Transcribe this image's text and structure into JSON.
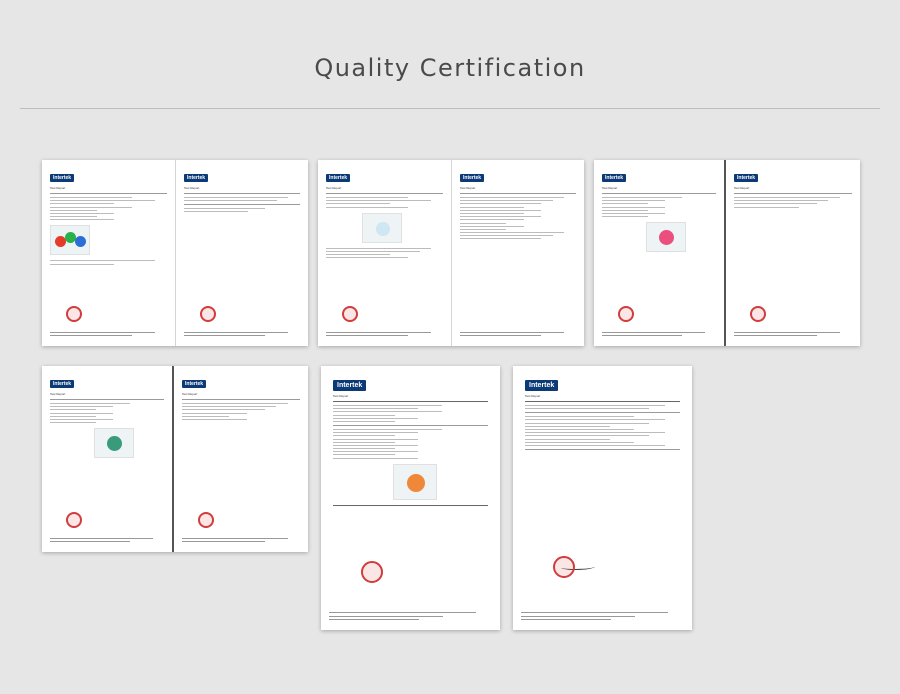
{
  "page_title": "Quality Certification",
  "colors": {
    "background": "#e6e6e6",
    "card": "#ffffff",
    "logo_blue": "#0b3a77",
    "stamp_red": "#d23c3c"
  },
  "brand_label": "Intertek",
  "report_label": "Test Report",
  "certificates": [
    {
      "id": "cert-1",
      "pages": 2
    },
    {
      "id": "cert-2",
      "pages": 2
    },
    {
      "id": "cert-3",
      "pages": 2
    },
    {
      "id": "cert-4",
      "pages": 2
    },
    {
      "id": "cert-5",
      "pages": 1
    },
    {
      "id": "cert-6",
      "pages": 1
    }
  ]
}
